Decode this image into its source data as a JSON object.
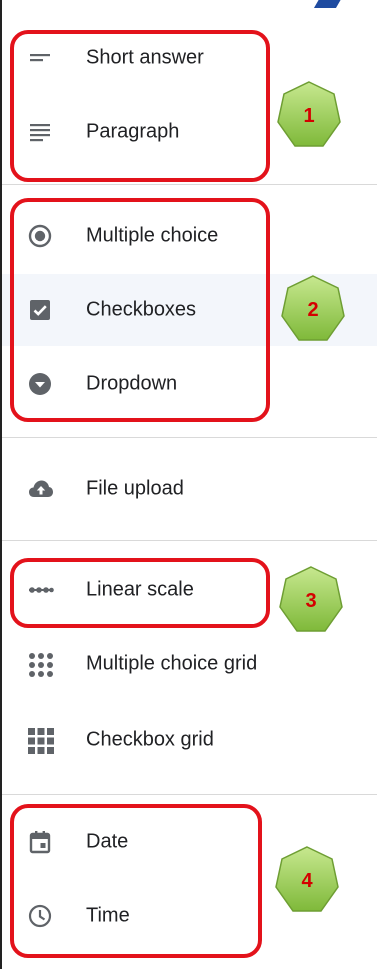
{
  "menu": {
    "items": [
      {
        "id": "short-answer",
        "label": "Short answer",
        "icon": "short-text-icon"
      },
      {
        "id": "paragraph",
        "label": "Paragraph",
        "icon": "paragraph-icon"
      },
      {
        "id": "multiple-choice",
        "label": "Multiple choice",
        "icon": "radio-button-icon"
      },
      {
        "id": "checkboxes",
        "label": "Checkboxes",
        "icon": "checkbox-icon"
      },
      {
        "id": "dropdown",
        "label": "Dropdown",
        "icon": "dropdown-icon"
      },
      {
        "id": "file-upload",
        "label": "File upload",
        "icon": "cloud-upload-icon"
      },
      {
        "id": "linear-scale",
        "label": "Linear scale",
        "icon": "linear-scale-icon"
      },
      {
        "id": "multiple-choice-grid",
        "label": "Multiple choice grid",
        "icon": "dot-grid-icon"
      },
      {
        "id": "checkbox-grid",
        "label": "Checkbox grid",
        "icon": "square-grid-icon"
      },
      {
        "id": "date",
        "label": "Date",
        "icon": "calendar-icon"
      },
      {
        "id": "time",
        "label": "Time",
        "icon": "clock-icon"
      }
    ]
  },
  "annotations": {
    "badge1": "1",
    "badge2": "2",
    "badge3": "3",
    "badge4": "4"
  },
  "colors": {
    "highlight": "#e3121b",
    "badge_fill": "#9bcf4f",
    "badge_text": "#d40000",
    "icon": "#5f6368"
  }
}
